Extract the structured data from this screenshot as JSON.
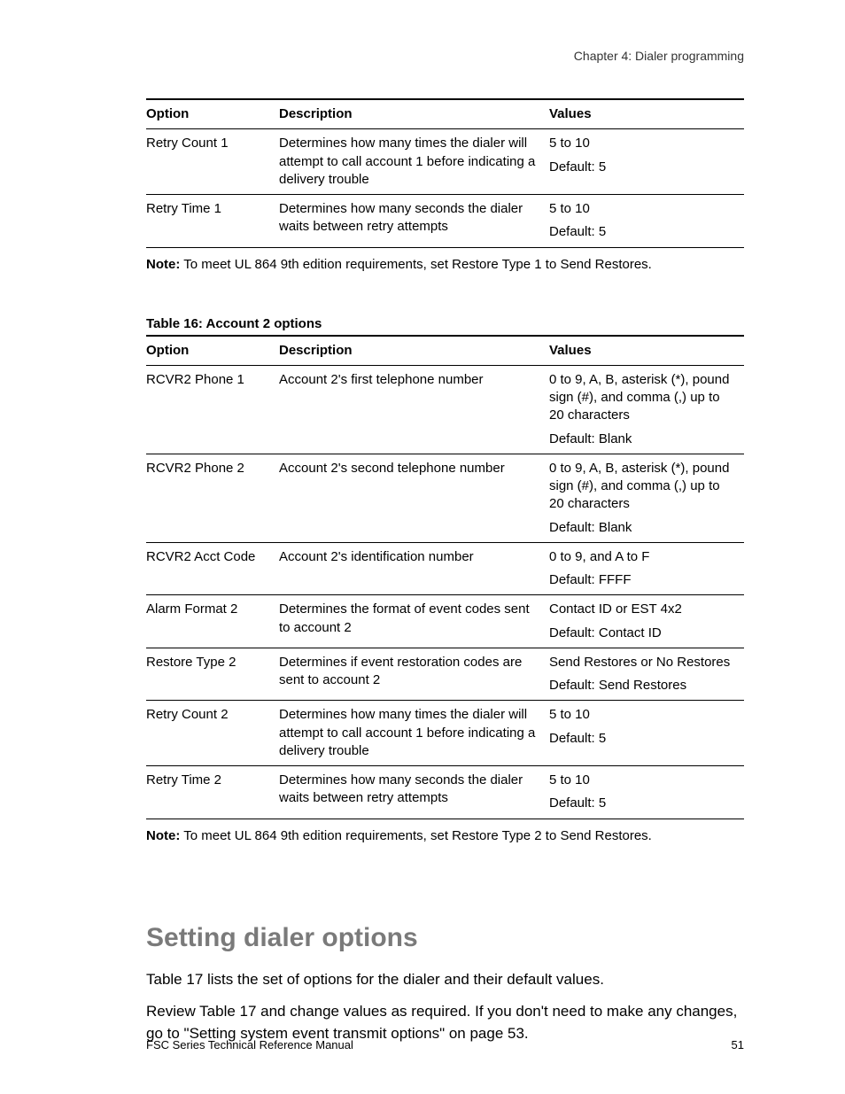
{
  "chapter": "Chapter 4: Dialer programming",
  "table1": {
    "headers": {
      "opt": "Option",
      "desc": "Description",
      "val": "Values"
    },
    "rows": [
      {
        "opt": "Retry Count 1",
        "desc": "Determines how many times the dialer will attempt to call account 1 before indicating a delivery trouble",
        "val": "5 to 10",
        "def": "Default: 5"
      },
      {
        "opt": "Retry Time 1",
        "desc": "Determines how many seconds the dialer waits between retry attempts",
        "val": "5 to 10",
        "def": "Default: 5"
      }
    ]
  },
  "note1_label": "Note:",
  "note1_text": " To meet UL 864 9th edition requirements, set Restore Type 1 to Send Restores.",
  "table2_caption": "Table 16: Account 2 options",
  "table2": {
    "headers": {
      "opt": "Option",
      "desc": "Description",
      "val": "Values"
    },
    "rows": [
      {
        "opt": "RCVR2 Phone 1",
        "desc": "Account 2's first telephone number",
        "val": "0 to 9, A, B, asterisk (*), pound sign (#), and comma (,) up to 20 characters",
        "def": "Default: Blank"
      },
      {
        "opt": "RCVR2 Phone 2",
        "desc": "Account 2's second telephone number",
        "val": "0 to 9, A, B, asterisk (*), pound sign (#), and comma (,) up to 20 characters",
        "def": "Default: Blank"
      },
      {
        "opt": "RCVR2 Acct Code",
        "desc": "Account 2's identification number",
        "val": "0 to 9, and A to F",
        "def": "Default: FFFF"
      },
      {
        "opt": "Alarm Format 2",
        "desc": "Determines the format of event codes sent to account 2",
        "val": "Contact ID or EST 4x2",
        "def": "Default: Contact ID"
      },
      {
        "opt": "Restore Type 2",
        "desc": "Determines if event restoration codes are sent to account 2",
        "val": "Send Restores or No Restores",
        "def": "Default: Send Restores"
      },
      {
        "opt": "Retry Count 2",
        "desc": "Determines how many times the dialer will attempt to call account 1 before indicating a delivery trouble",
        "val": "5 to 10",
        "def": "Default: 5"
      },
      {
        "opt": "Retry Time 2",
        "desc": "Determines how many seconds the dialer waits between retry attempts",
        "val": "5 to 10",
        "def": "Default: 5"
      }
    ]
  },
  "note2_label": "Note:",
  "note2_text": " To meet UL 864 9th edition requirements, set Restore Type 2 to Send Restores.",
  "section_heading": "Setting dialer options",
  "body1": "Table 17 lists the set of options for the dialer and their default values.",
  "body2": "Review Table 17 and change values as required. If you don't need to make any changes, go to \"Setting system event transmit options\" on page 53.",
  "footer_left": "FSC Series Technical Reference Manual",
  "footer_right": "51"
}
